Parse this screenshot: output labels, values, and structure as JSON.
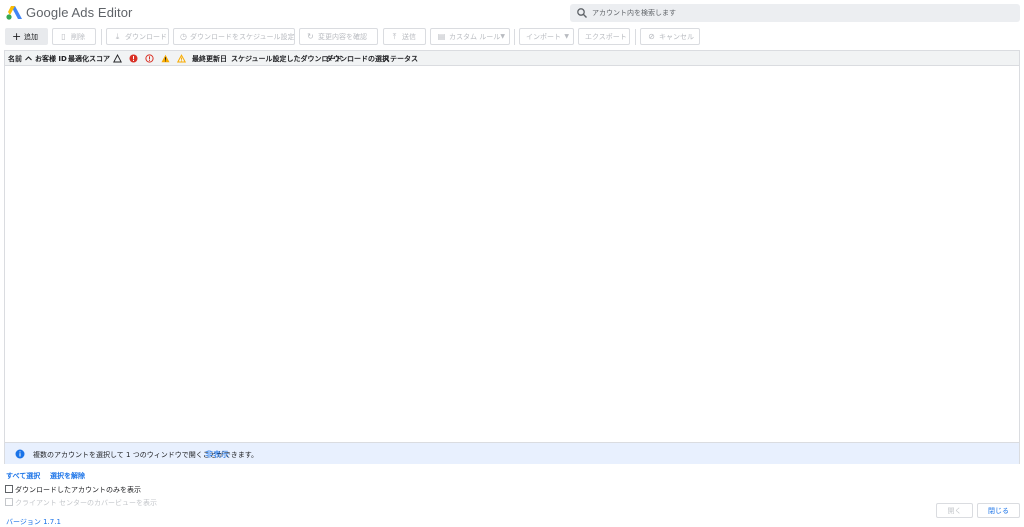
{
  "header": {
    "app_title": "Google Ads Editor",
    "search_placeholder": "アカウント内を検索します",
    "logo_colors": {
      "blue": "#4285f4",
      "yellow": "#fbbc04",
      "green": "#34a853"
    }
  },
  "toolbar": {
    "add": {
      "label": "追加",
      "icon": "plus-icon"
    },
    "delete": {
      "label": "削除",
      "icon": "trash-icon"
    },
    "download": {
      "label": "ダウンロード",
      "icon": "download-icon"
    },
    "schedule_download": {
      "label": "ダウンロードをスケジュール設定",
      "icon": "clock-icon"
    },
    "review_changes": {
      "label": "変更内容を確認",
      "icon": "refresh-icon"
    },
    "post": {
      "label": "送信",
      "icon": "upload-icon"
    },
    "custom_rules": {
      "label": "カスタム ルール",
      "icon": "document-icon"
    },
    "import": {
      "label": "インポート"
    },
    "export": {
      "label": "エクスポート"
    },
    "cancel": {
      "label": "キャンセル",
      "icon": "cancel-icon"
    }
  },
  "table": {
    "columns": {
      "name": "名前",
      "customer_id": "お客様 ID",
      "optimization_score": "最適化スコア",
      "last_updated": "最終更新日",
      "scheduled_download": "スケジュール設定したダウンロード",
      "download_selection": "ダウンロードの選択",
      "status": "ステータス"
    },
    "rows": [],
    "status_icon_colors": {
      "error": "#d93025",
      "warning": "#f9ab00"
    }
  },
  "info_bar": {
    "message": "複数のアカウントを選択して 1 つのウィンドウで開くことができます。",
    "hide_link": "非表示"
  },
  "footer": {
    "select_all": "すべて選択",
    "deselect": "選択を解除",
    "show_downloaded_only": "ダウンロードしたアカウントのみを表示",
    "show_client_center": "クライアント センターのカバービューを表示",
    "version_label": "バージョン 1.7.1",
    "open_button": "開く",
    "close_button": "閉じる"
  }
}
